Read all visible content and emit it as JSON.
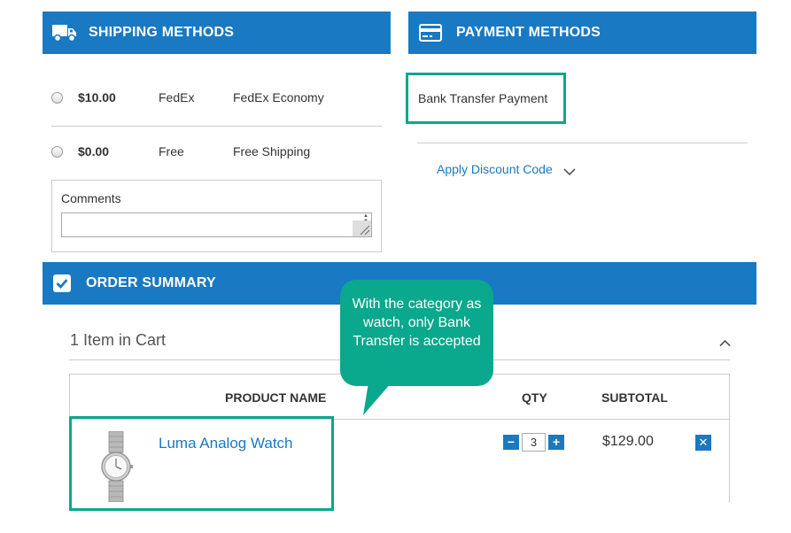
{
  "shipping": {
    "title": "SHIPPING METHODS",
    "icon": "truck-icon",
    "options": [
      {
        "price": "$10.00",
        "carrier": "FedEx",
        "method": "FedEx Economy",
        "selected": false
      },
      {
        "price": "$0.00",
        "carrier": "Free",
        "method": "Free Shipping",
        "selected": false
      }
    ],
    "comments_label": "Comments",
    "comments_value": ""
  },
  "payment": {
    "title": "PAYMENT METHODS",
    "icon": "credit-card-icon",
    "method": "Bank Transfer Payment",
    "discount_label": "Apply Discount Code"
  },
  "order_summary": {
    "title": "ORDER SUMMARY",
    "icon": "checkbox-checked-icon",
    "items_count_label": "1 Item in Cart",
    "columns": {
      "product": "PRODUCT NAME",
      "qty": "QTY",
      "subtotal": "SUBTOTAL"
    },
    "items": [
      {
        "name": "Luma Analog Watch",
        "qty": "3",
        "subtotal": "$129.00"
      }
    ]
  },
  "annotation": {
    "text": "With the category as watch, only Bank Transfer is accepted"
  },
  "colors": {
    "header_blue": "#1979c3",
    "highlight_green": "#0aa88c",
    "link_blue": "#1979c3"
  }
}
